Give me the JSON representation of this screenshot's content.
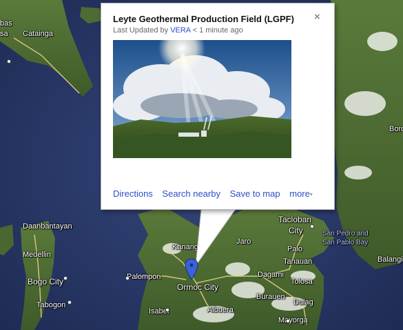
{
  "infowindow": {
    "title": "Leyte Geothermal Production Field (LGPF)",
    "updated_prefix": "Last Updated by",
    "updated_user": "VERA",
    "updated_suffix": "< 1 minute ago",
    "close_symbol": "×",
    "links": {
      "directions": "Directions",
      "search_nearby": "Search nearby",
      "save_to_map": "Save to map",
      "more": "more"
    },
    "more_arrow": "▾"
  },
  "map_labels": {
    "catainga": "Catainga",
    "bas": "bas",
    "sa": "sa",
    "daanbantayan": "Daanbantayan",
    "medellin": "Medellin",
    "bogo_city": "Bogo City",
    "tabogon": "Tabogon",
    "kananga": "Kananga",
    "palompon": "Palompon",
    "ormoc_city": "Ormoc City",
    "isabel": "Isabel",
    "albuera": "Albuera",
    "jaro": "Jaro",
    "tacloban": "Tacloban",
    "tacloban_city": "City",
    "palo": "Palo",
    "tanauan": "Tanauan",
    "dagami": "Dagami",
    "tolosa": "Tolosa",
    "burauen": "Burauen",
    "dulag": "Dulag",
    "mayorga": "Mayorga",
    "san_pedro": "San Pedro and",
    "san_pablo_bay": "San Pablo Bay",
    "balangiga": "Balangig",
    "boro": "Boro"
  },
  "icons": {
    "marker": "map-pin-icon",
    "close": "close-icon"
  },
  "colors": {
    "link": "#2b4fc9",
    "sea": "#2a3a6a",
    "land": "#4f6b34",
    "marker": "#3b62d8"
  }
}
